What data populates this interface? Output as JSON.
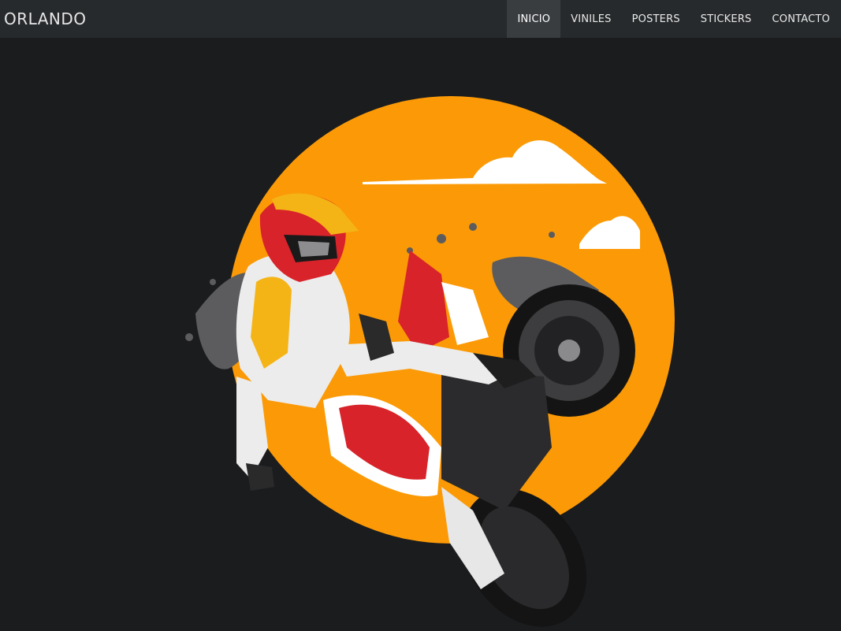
{
  "nav": {
    "brand": "ORLANDO",
    "links": [
      {
        "label": "INICIO",
        "active": true
      },
      {
        "label": "VINILES",
        "active": false
      },
      {
        "label": "POSTERS",
        "active": false
      },
      {
        "label": "STICKERS",
        "active": false
      },
      {
        "label": "CONTACTO",
        "active": false
      }
    ]
  },
  "hero": {
    "image": "motocross-rider-illustration"
  },
  "colors": {
    "navbar_bg": "#272a2c",
    "page_bg": "#1b1c1e",
    "active_link_bg": "#3a3d40",
    "sun": "#fb9a06",
    "accent_red": "#d8232a",
    "accent_yellow": "#f5b416"
  }
}
